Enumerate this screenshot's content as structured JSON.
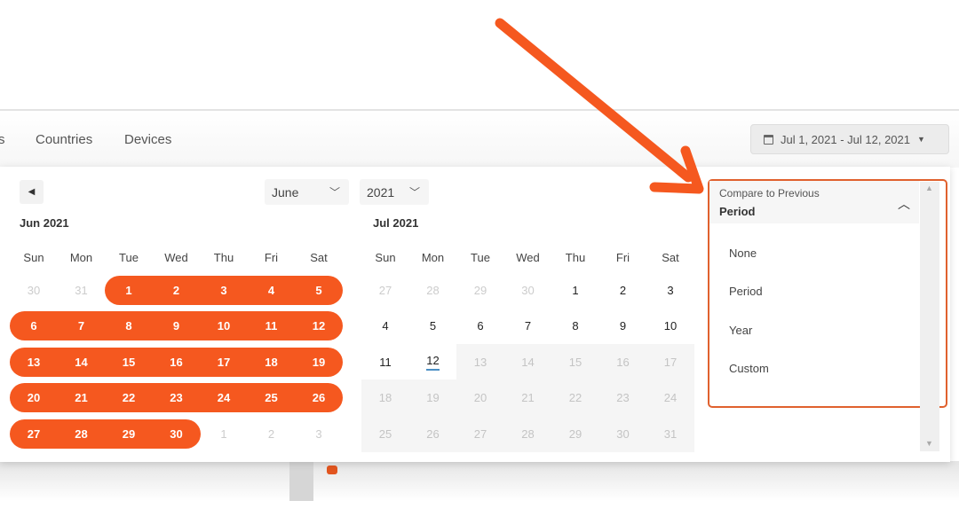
{
  "tabs": [
    {
      "label": "s"
    },
    {
      "label": "Countries"
    },
    {
      "label": "Devices"
    }
  ],
  "date_range": {
    "label": "Jul 1, 2021 - Jul 12, 2021",
    "icon": "calendar-icon"
  },
  "picker": {
    "month_select": "June",
    "year_select": "2021",
    "weekdays": [
      "Sun",
      "Mon",
      "Tue",
      "Wed",
      "Thu",
      "Fri",
      "Sat"
    ],
    "months": [
      {
        "title": "Jun 2021",
        "weeks": [
          [
            [
              30,
              "out"
            ],
            [
              31,
              "out"
            ],
            [
              1,
              "selected"
            ],
            [
              2,
              "selected"
            ],
            [
              3,
              "selected"
            ],
            [
              4,
              "selected"
            ],
            [
              5,
              "selected"
            ]
          ],
          [
            [
              6,
              "selected"
            ],
            [
              7,
              "selected"
            ],
            [
              8,
              "selected"
            ],
            [
              9,
              "selected"
            ],
            [
              10,
              "selected"
            ],
            [
              11,
              "selected"
            ],
            [
              12,
              "selected"
            ]
          ],
          [
            [
              13,
              "selected"
            ],
            [
              14,
              "selected"
            ],
            [
              15,
              "selected"
            ],
            [
              16,
              "selected"
            ],
            [
              17,
              "selected"
            ],
            [
              18,
              "selected"
            ],
            [
              19,
              "selected"
            ]
          ],
          [
            [
              20,
              "selected"
            ],
            [
              21,
              "selected"
            ],
            [
              22,
              "selected"
            ],
            [
              23,
              "selected"
            ],
            [
              24,
              "selected"
            ],
            [
              25,
              "selected"
            ],
            [
              26,
              "selected"
            ]
          ],
          [
            [
              27,
              "selected"
            ],
            [
              28,
              "selected"
            ],
            [
              29,
              "selected"
            ],
            [
              30,
              "selected"
            ],
            [
              1,
              "out"
            ],
            [
              2,
              "out"
            ],
            [
              3,
              "out"
            ]
          ]
        ]
      },
      {
        "title": "Jul 2021",
        "weeks": [
          [
            [
              27,
              "out"
            ],
            [
              28,
              "out"
            ],
            [
              29,
              "out"
            ],
            [
              30,
              "out"
            ],
            [
              1,
              "normal"
            ],
            [
              2,
              "normal"
            ],
            [
              3,
              "normal"
            ]
          ],
          [
            [
              4,
              "normal"
            ],
            [
              5,
              "normal"
            ],
            [
              6,
              "normal"
            ],
            [
              7,
              "normal"
            ],
            [
              8,
              "normal"
            ],
            [
              9,
              "normal"
            ],
            [
              10,
              "normal"
            ]
          ],
          [
            [
              11,
              "normal"
            ],
            [
              12,
              "today"
            ],
            [
              13,
              "disabled"
            ],
            [
              14,
              "disabled"
            ],
            [
              15,
              "disabled"
            ],
            [
              16,
              "disabled"
            ],
            [
              17,
              "disabled"
            ]
          ],
          [
            [
              18,
              "disabled"
            ],
            [
              19,
              "disabled"
            ],
            [
              20,
              "disabled"
            ],
            [
              21,
              "disabled"
            ],
            [
              22,
              "disabled"
            ],
            [
              23,
              "disabled"
            ],
            [
              24,
              "disabled"
            ]
          ],
          [
            [
              25,
              "disabled"
            ],
            [
              26,
              "disabled"
            ],
            [
              27,
              "disabled"
            ],
            [
              28,
              "disabled"
            ],
            [
              29,
              "disabled"
            ],
            [
              30,
              "disabled"
            ],
            [
              31,
              "disabled"
            ]
          ]
        ]
      }
    ]
  },
  "compare": {
    "label": "Compare to Previous",
    "value": "Period",
    "options": [
      "None",
      "Period",
      "Year",
      "Custom"
    ]
  },
  "colors": {
    "accent": "#f5581f",
    "highlight_border": "#e0612e",
    "today_underline": "#4a8fc4"
  }
}
